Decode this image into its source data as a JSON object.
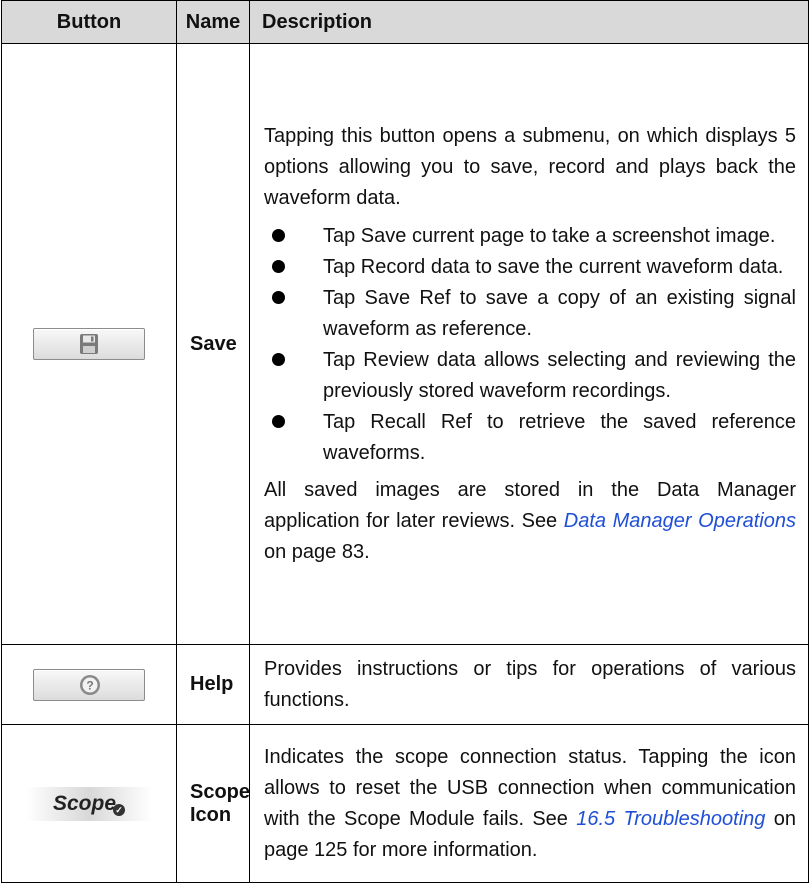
{
  "header": {
    "col_button": "Button",
    "col_name": "Name",
    "col_description": "Description"
  },
  "rows": [
    {
      "icon": "floppy-disk-icon",
      "name": "Save",
      "intro": "Tapping this button opens a submenu, on which displays 5 options allowing you to save, record and plays back the waveform data.",
      "bullets": [
        "Tap Save current page to take a screenshot image.",
        "Tap Record data to save the current waveform data.",
        "Tap Save Ref to save a copy of an existing signal waveform as reference.",
        "Tap Review data allows selecting and reviewing the previously stored waveform recordings.",
        "Tap Recall Ref to retrieve the saved reference waveforms."
      ],
      "outro_before": "All saved images are stored in the Data Manager application for later reviews. See ",
      "outro_link": "Data Manager Operations",
      "outro_after": " on page 83."
    },
    {
      "icon": "help-question-icon",
      "name": "Help",
      "description": "Provides instructions or tips for operations of various functions."
    },
    {
      "icon": "scope-status-icon",
      "icon_text": "Scope",
      "name": "Scope Icon",
      "desc_before": "Indicates the scope connection status. Tapping the icon allows to reset the USB connection when communication with the Scope Module fails. See ",
      "desc_link": "16.5 Troubleshooting",
      "desc_after": " on page 125 for more information."
    }
  ]
}
